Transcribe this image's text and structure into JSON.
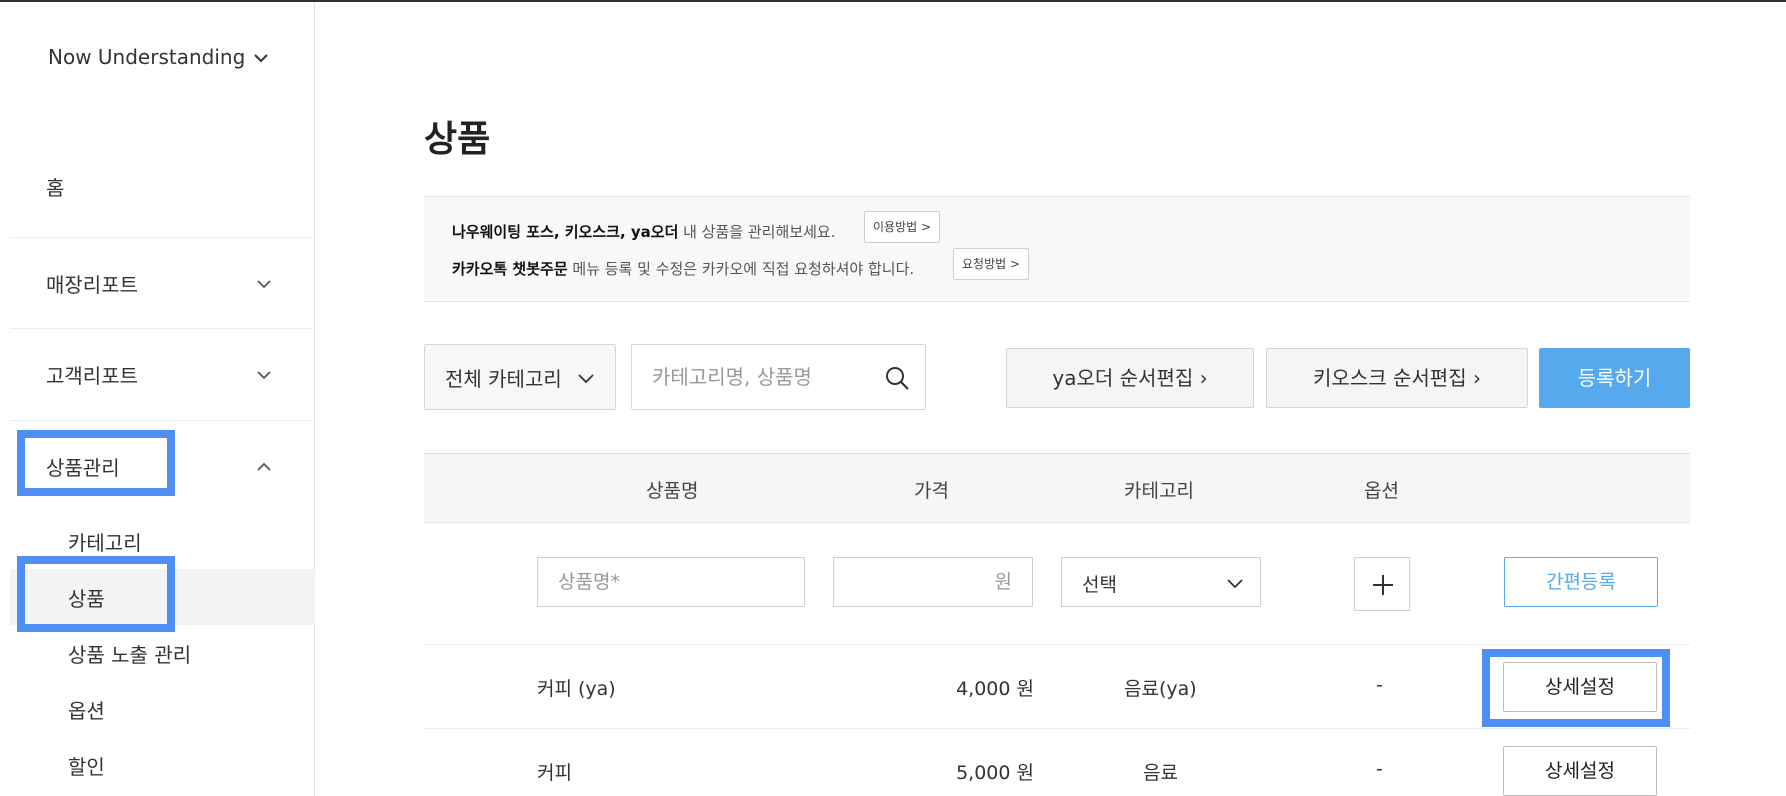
{
  "sidebar": {
    "store_name": "Now Understanding",
    "home": "홈",
    "groups": [
      {
        "label": "매장리포트"
      },
      {
        "label": "고객리포트"
      },
      {
        "label": "상품관리"
      }
    ],
    "sub_items": [
      {
        "label": "카테고리"
      },
      {
        "label": "상품"
      },
      {
        "label": "상품 노출 관리"
      },
      {
        "label": "옵션"
      },
      {
        "label": "할인"
      }
    ],
    "active_item": "상품",
    "highlight_color": "#4f8ef3"
  },
  "page": {
    "title": "상품"
  },
  "notice": {
    "line1_bold": "나우웨이팅 포스, 키오스크, ya오더",
    "line1_text": " 내 상품을 관리해보세요.",
    "line1_button": "이용방법 >",
    "line2_bold": "카카오톡 챗봇주문",
    "line2_text": " 메뉴 등록 및 수정은 카카오에 직접 요청하셔야 합니다.",
    "line2_button": "요청방법 >"
  },
  "toolbar": {
    "category_select": "전체 카테고리",
    "search_placeholder": "카테고리명, 상품명",
    "yaorder_edit": "ya오더 순서편집",
    "kiosk_edit": "키오스크 순서편집",
    "register": "등록하기",
    "accent_color": "#55a9ec"
  },
  "table": {
    "headers": [
      "상품명",
      "가격",
      "카테고리",
      "옵션"
    ],
    "quick": {
      "name_placeholder": "상품명*",
      "price_placeholder": "원",
      "category_value": "선택",
      "plus": "+",
      "quick_register": "간편등록"
    },
    "rows": [
      {
        "name": "커피 (ya)",
        "price": "4,000 원",
        "category": "음료(ya)",
        "option": "-",
        "action": "상세설정"
      },
      {
        "name": "커피",
        "price": "5,000 원",
        "category": "음료",
        "option": "-",
        "action": "상세설정"
      }
    ]
  }
}
